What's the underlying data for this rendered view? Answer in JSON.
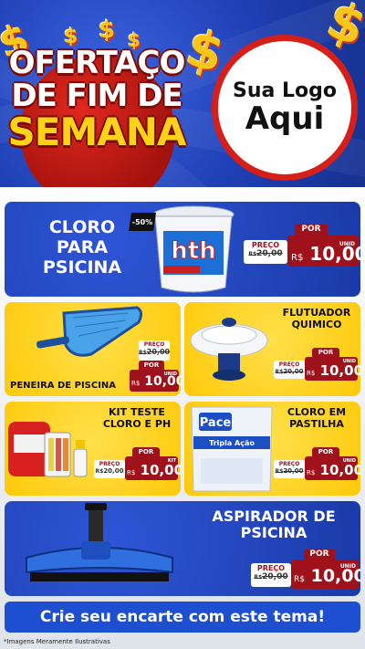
{
  "header": {
    "title_line1": "OFERTAÇO",
    "title_line2": "DE FIM DE",
    "title_line3": "SEMANA",
    "logo_line1": "Sua Logo",
    "logo_line2": "Aqui",
    "dollar": "$"
  },
  "products": [
    {
      "title_l1": "CLORO",
      "title_l2": "PARA",
      "title_l3": "PSICINA",
      "badge": "-50%",
      "brand": "hth",
      "por": "POR",
      "preco": "PREÇO",
      "old_rs": "R$",
      "old": "20,00",
      "new_rs": "R$",
      "new": "10,00",
      "unit": "UNID"
    },
    {
      "title_l1": "PENEIRA DE PISCINA",
      "por": "POR",
      "preco": "PREÇO",
      "old_rs": "R$",
      "old": "20,00",
      "new_rs": "R$",
      "new": "10,00",
      "unit": "UNID"
    },
    {
      "title_l1": "FLUTUADOR",
      "title_l2": "QUIMICO",
      "por": "POR",
      "preco": "PREÇO",
      "old_rs": "R$",
      "old": "20,00",
      "new_rs": "R$",
      "new": "10,00",
      "unit": "UNID"
    },
    {
      "title_l1": "KIT TESTE",
      "title_l2": "CLORO E PH",
      "por": "POR",
      "preco": "PREÇO",
      "old_rs": "R$",
      "old": "20,00",
      "new_rs": "R$",
      "new": "10,00",
      "unit": "KIT"
    },
    {
      "title_l1": "CLORO EM",
      "title_l2": "PASTILHA",
      "brand": "Pace",
      "brand_sub": "Tripla Ação",
      "por": "POR",
      "preco": "PREÇO",
      "old_rs": "R$",
      "old": "20,00",
      "new_rs": "R$",
      "new": "10,00",
      "unit": "UNID"
    },
    {
      "title_l1": "ASPIRADOR DE",
      "title_l2": "PSICINA",
      "por": "POR",
      "preco": "PREÇO",
      "old_rs": "R$",
      "old": "20,00",
      "new_rs": "R$",
      "new": "10,00",
      "unit": "UNID"
    }
  ],
  "cta": "Crie seu encarte com este tema!",
  "footnote": "*Imagens Meramente Ilustrativas",
  "colors": {
    "brand_blue": "#1e3fb4",
    "accent_red": "#a0121b",
    "accent_yellow": "#ffc90a"
  }
}
